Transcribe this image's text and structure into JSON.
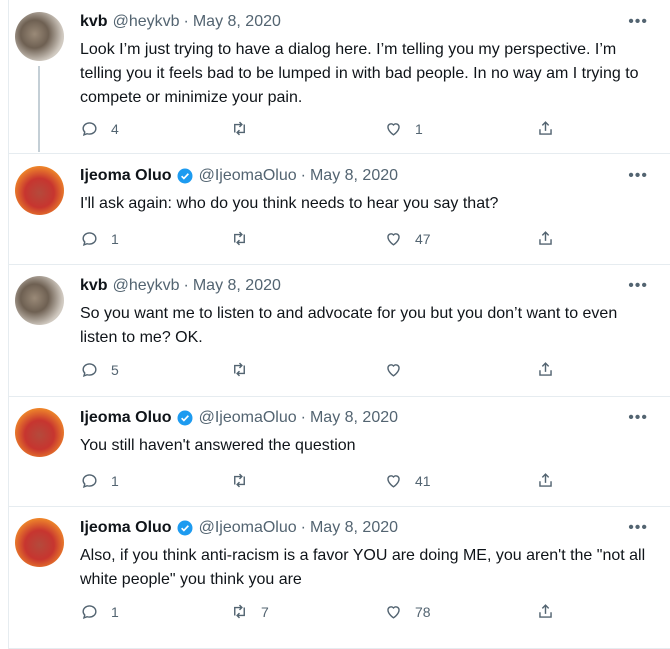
{
  "tweets": [
    {
      "name": "kvb",
      "handle": "@heykvb",
      "date": "May 8, 2020",
      "verified": false,
      "avatar": "kvb-avatar",
      "text": "Look I’m just trying to have a dialog here. I’m telling you my perspective. I’m telling you it feels bad to be lumped in with bad people. In no way am I trying to compete or minimize your pain.",
      "replies": "4",
      "retweets": "",
      "likes": "1"
    },
    {
      "name": "Ijeoma Oluo",
      "handle": "@IjeomaOluo",
      "date": "May 8, 2020",
      "verified": true,
      "avatar": "ijeoma-avatar",
      "text": "I'll ask again: who do you think needs to hear you say that?",
      "replies": "1",
      "retweets": "",
      "likes": "47"
    },
    {
      "name": "kvb",
      "handle": "@heykvb",
      "date": "May 8, 2020",
      "verified": false,
      "avatar": "kvb-avatar",
      "text": "So you want me to listen to and advocate for you but you don’t want to even listen to me? OK.",
      "replies": "5",
      "retweets": "",
      "likes": ""
    },
    {
      "name": "Ijeoma Oluo",
      "handle": "@IjeomaOluo",
      "date": "May 8, 2020",
      "verified": true,
      "avatar": "ijeoma-avatar",
      "text": "You still haven't answered the question",
      "replies": "1",
      "retweets": "",
      "likes": "41"
    },
    {
      "name": "Ijeoma Oluo",
      "handle": "@IjeomaOluo",
      "date": "May 8, 2020",
      "verified": true,
      "avatar": "ijeoma-avatar",
      "text": "Also, if you think anti-racism is a favor YOU are doing ME, you aren't the \"not all white people\" you think you are",
      "replies": "1",
      "retweets": "7",
      "likes": "78"
    }
  ],
  "ui": {
    "more_label": "•••",
    "dot": "·",
    "icons": [
      "reply-icon",
      "retweet-icon",
      "like-icon",
      "share-icon",
      "verified-icon",
      "more-icon"
    ],
    "colors": {
      "text": "#0f1419",
      "muted": "#536471",
      "verified": "#1d9bf0",
      "border": "#e6ecf0"
    }
  }
}
